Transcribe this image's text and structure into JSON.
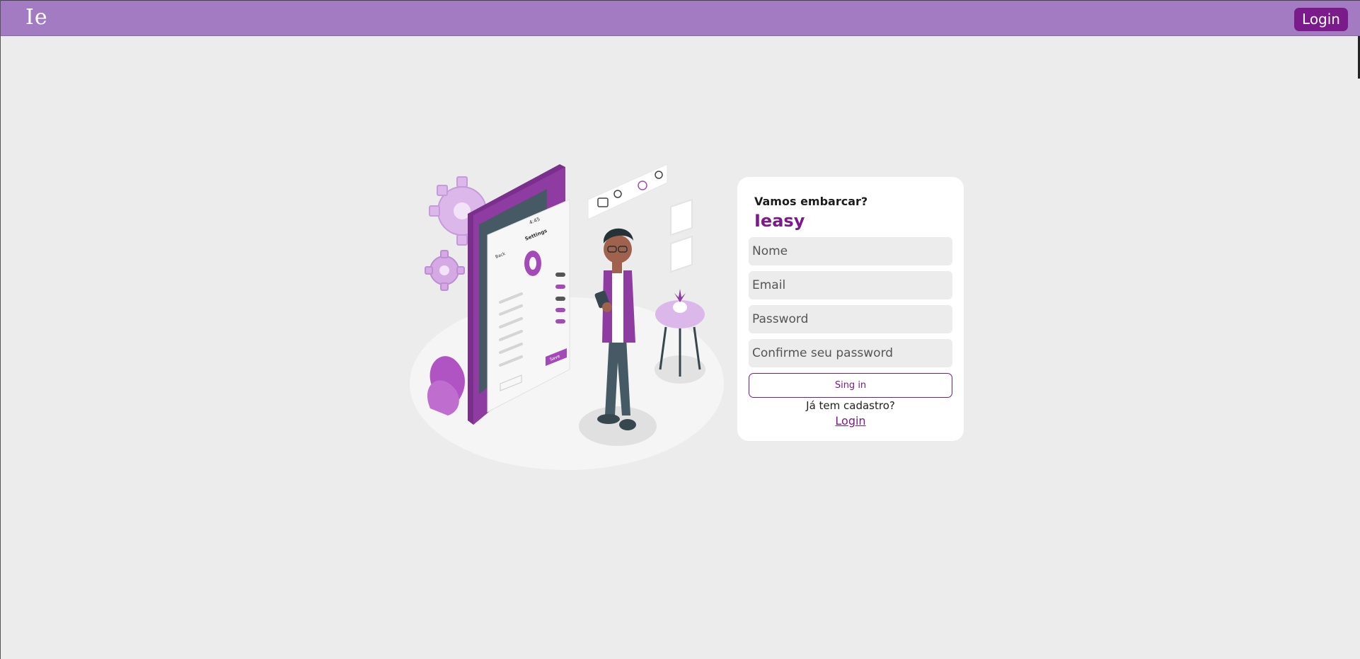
{
  "header": {
    "logo_text": "Ie",
    "login_label": "Login"
  },
  "form": {
    "subtitle": "Vamos embarcar?",
    "title": "Ieasy",
    "fields": {
      "name_placeholder": "Nome",
      "email_placeholder": "Email",
      "password_placeholder": "Password",
      "confirm_placeholder": "Confirme seu password"
    },
    "submit_label": "Sing in",
    "question": "Já tem cadastro?",
    "login_link": "Login"
  },
  "illustration": {
    "phone": {
      "status": "4:45",
      "screen_title": "Settings",
      "back_label": "Back",
      "save_label": "Save"
    }
  },
  "colors": {
    "header_bg": "#a27bc2",
    "accent": "#7b1a8a",
    "page_bg": "#ececec",
    "card_bg": "#ffffff"
  }
}
